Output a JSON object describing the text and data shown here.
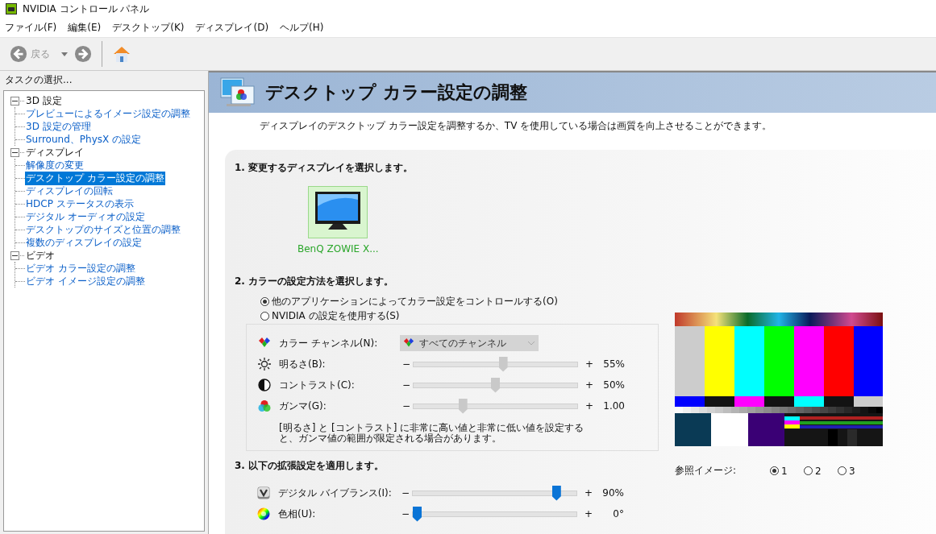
{
  "window": {
    "title": "NVIDIA コントロール パネル"
  },
  "menu": [
    "ファイル(F)",
    "編集(E)",
    "デスクトップ(K)",
    "ディスプレイ(D)",
    "ヘルプ(H)"
  ],
  "toolbar": {
    "back": {
      "label": "戻る",
      "disabled": true
    }
  },
  "sidebar": {
    "title": "タスクの選択...",
    "tree": [
      {
        "label": "3D 設定",
        "expanded": true,
        "children": [
          {
            "label": "プレビューによるイメージ設定の調整",
            "selected": false
          },
          {
            "label": "3D 設定の管理",
            "selected": false
          },
          {
            "label": "Surround、PhysX の設定",
            "selected": false
          }
        ]
      },
      {
        "label": "ディスプレイ",
        "expanded": true,
        "children": [
          {
            "label": "解像度の変更",
            "selected": false
          },
          {
            "label": "デスクトップ カラー設定の調整",
            "selected": true
          },
          {
            "label": "ディスプレイの回転",
            "selected": false
          },
          {
            "label": "HDCP ステータスの表示",
            "selected": false
          },
          {
            "label": "デジタル オーディオの設定",
            "selected": false
          },
          {
            "label": "デスクトップのサイズと位置の調整",
            "selected": false
          },
          {
            "label": "複数のディスプレイの設定",
            "selected": false
          }
        ]
      },
      {
        "label": "ビデオ",
        "expanded": true,
        "children": [
          {
            "label": "ビデオ カラー設定の調整",
            "selected": false
          },
          {
            "label": "ビデオ イメージ設定の調整",
            "selected": false
          }
        ]
      }
    ]
  },
  "page": {
    "title": "デスクトップ カラー設定の調整",
    "description": "ディスプレイのデスクトップ カラー設定を調整するか、TV を使用している場合は画質を向上させることができます。",
    "section1": {
      "heading": "1. 変更するディスプレイを選択します。",
      "displays": [
        {
          "label": "BenQ ZOWIE X...",
          "selected": true
        }
      ]
    },
    "section2": {
      "heading": "2. カラーの設定方法を選択します。",
      "options": [
        {
          "label": "他のアプリケーションによってカラー設定をコントロールする(O)",
          "selected": true
        },
        {
          "label": "NVIDIA の設定を使用する(S)",
          "selected": false
        }
      ],
      "channel": {
        "label": "カラー チャンネル(N):",
        "value": "すべてのチャンネル",
        "disabled": true
      },
      "sliders": [
        {
          "kind": "brightness",
          "label": "明るさ(B):",
          "minus": "−",
          "plus": "+",
          "level": 0.55,
          "reading": "55%",
          "disabled": true
        },
        {
          "kind": "contrast",
          "label": "コントラスト(C):",
          "minus": "−",
          "plus": "+",
          "level": 0.5,
          "reading": "50%",
          "disabled": true
        },
        {
          "kind": "gamma",
          "label": "ガンマ(G):",
          "minus": "−",
          "plus": "+",
          "level": 0.29,
          "reading": "1.00",
          "disabled": true
        }
      ],
      "note": "[明るさ] と [コントラスト] に非常に高い値と非常に低い値を設定すると、ガンマ値の範囲が限定される場合があります。"
    },
    "section3": {
      "heading": "3. 以下の拡張設定を適用します。",
      "sliders": [
        {
          "kind": "vibrance",
          "label": "デジタル バイブランス(I):",
          "minus": "−",
          "plus": "+",
          "level": 0.9,
          "reading": "90%",
          "disabled": false
        },
        {
          "kind": "hue",
          "label": "色相(U):",
          "minus": "−",
          "plus": "+",
          "level": 0.0,
          "reading": "0°",
          "disabled": false
        }
      ]
    },
    "reference": {
      "label": "参照イメージ:",
      "options": [
        {
          "label": "1",
          "selected": true
        },
        {
          "label": "2",
          "selected": false
        },
        {
          "label": "3",
          "selected": false
        }
      ]
    }
  }
}
